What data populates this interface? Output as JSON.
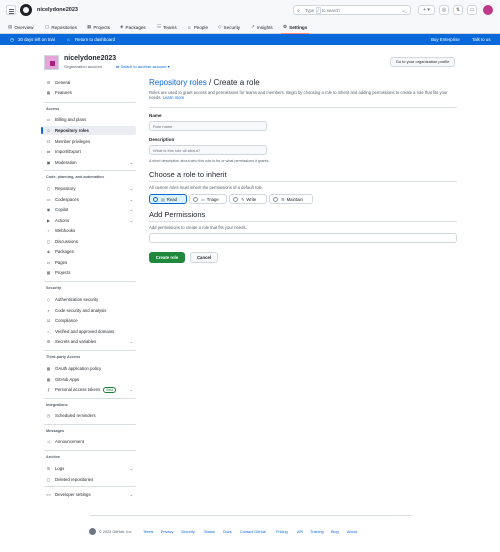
{
  "header": {
    "org": "nicelydone2023",
    "search_type": "Type",
    "search_rest": "to search",
    "search_slash": "/",
    "command_icon": ">_",
    "plus_icon": "+ ▾",
    "tabs": [
      {
        "label": "Overview",
        "icon": "book-icon"
      },
      {
        "label": "Repositories",
        "icon": "repo-icon"
      },
      {
        "label": "Projects",
        "icon": "table-icon"
      },
      {
        "label": "Packages",
        "icon": "package-icon"
      },
      {
        "label": "Teams",
        "icon": "people-icon"
      },
      {
        "label": "People",
        "icon": "person-icon"
      },
      {
        "label": "Security",
        "icon": "shield-icon"
      },
      {
        "label": "Insights",
        "icon": "graph-icon"
      },
      {
        "label": "Settings",
        "icon": "gear-icon"
      }
    ]
  },
  "banner": {
    "trial": "30 days left on trial",
    "dashboard": "Return to dashboard",
    "buy": "Buy Enterprise",
    "talk": "Talk to us"
  },
  "org": {
    "name": "nicelydone2023",
    "type": "Organization account",
    "switch": "Switch to another account",
    "switch_caret": "▾",
    "profile_button": "Go to your organization profile"
  },
  "sidebar": {
    "top": [
      {
        "label": "General",
        "icon": "gear-icon"
      },
      {
        "label": "Features",
        "icon": "table-icon"
      }
    ],
    "access_title": "Access",
    "access": [
      {
        "label": "Billing and plans",
        "icon": "credit-card-icon"
      },
      {
        "label": "Repository roles",
        "icon": "person-icon"
      },
      {
        "label": "Member privileges",
        "icon": "people-icon"
      },
      {
        "label": "Import/Export",
        "icon": "arrow-switch-icon"
      },
      {
        "label": "Moderation",
        "icon": "report-icon"
      }
    ],
    "code_title": "Code, planning, and automation",
    "code": [
      {
        "label": "Repository",
        "icon": "repo-icon"
      },
      {
        "label": "Codespaces",
        "icon": "codespaces-icon"
      },
      {
        "label": "Copilot",
        "icon": "copilot-icon"
      },
      {
        "label": "Actions",
        "icon": "play-icon"
      },
      {
        "label": "Webhooks",
        "icon": "webhook-icon"
      },
      {
        "label": "Discussions",
        "icon": "comment-icon"
      },
      {
        "label": "Packages",
        "icon": "package-icon"
      },
      {
        "label": "Pages",
        "icon": "browser-icon"
      },
      {
        "label": "Projects",
        "icon": "table-icon"
      }
    ],
    "security_title": "Security",
    "security": [
      {
        "label": "Authentication security",
        "icon": "shield-lock-icon"
      },
      {
        "label": "Code security and analysis",
        "icon": "codescan-icon"
      },
      {
        "label": "Compliance",
        "icon": "checklist-icon"
      },
      {
        "label": "Verified and approved domains",
        "icon": "verified-icon"
      },
      {
        "label": "Secrets and variables",
        "icon": "key-icon"
      }
    ],
    "third_title": "Third-party Access",
    "third": [
      {
        "label": "OAuth application policy",
        "icon": "apps-icon"
      },
      {
        "label": "GitHub Apps",
        "icon": "apps-icon"
      },
      {
        "label": "Personal access tokens",
        "icon": "key-icon"
      }
    ],
    "beta": "Beta",
    "integrations_title": "Integrations",
    "integrations": [
      {
        "label": "Scheduled reminders",
        "icon": "clock-icon"
      }
    ],
    "messages_title": "Messages",
    "messages": [
      {
        "label": "Announcement",
        "icon": "megaphone-icon"
      }
    ],
    "archive_title": "Archive",
    "archive": [
      {
        "label": "Logs",
        "icon": "log-icon"
      },
      {
        "label": "Deleted repositories",
        "icon": "repo-deleted-icon"
      }
    ],
    "developer": {
      "label": "Developer settings",
      "icon": "code-icon"
    }
  },
  "main": {
    "crumb_link": "Repository roles",
    "crumb_sep": " / ",
    "crumb_current": "Create a role",
    "desc": "Roles are used to grant access and permissions for teams and members. Begin by choosing a role to inherit and adding permissions to create a role that fits your needs. ",
    "learn_more": "Learn more",
    "name_label": "Name",
    "name_placeholder": "Role name",
    "desc_label": "Description",
    "desc_placeholder": "What is this role all about?",
    "desc_hint": "A short description about who this role is for or what permissions it grants.",
    "inherit_title": "Choose a role to inherit",
    "inherit_sub": "All custom roles must inherit the permissions of a default role.",
    "roles": [
      {
        "label": "Read",
        "icon": "book-icon",
        "selected": true
      },
      {
        "label": "Triage",
        "icon": "inbox-icon",
        "selected": false
      },
      {
        "label": "Write",
        "icon": "pencil-icon",
        "selected": false
      },
      {
        "label": "Maintain",
        "icon": "tools-icon",
        "selected": false
      }
    ],
    "perm_title": "Add Permissions",
    "perm_sub": "Add permissions to create a role that fits your needs.",
    "create": "Create role",
    "cancel": "Cancel"
  },
  "footer": {
    "copy": "© 2023 GitHub, Inc.",
    "links": [
      "Terms",
      "Privacy",
      "Security",
      "Status",
      "Docs",
      "Contact GitHub",
      "Pricing",
      "API",
      "Training",
      "Blog",
      "About"
    ]
  },
  "colors": {
    "accent": "#0969da",
    "primary_button": "#1f883d",
    "tab_underline": "#fd8c73"
  }
}
